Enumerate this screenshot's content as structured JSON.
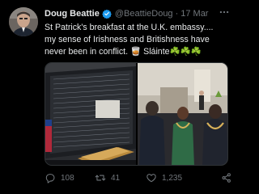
{
  "author": {
    "name": "Doug Beattie",
    "handle": "@BeattieDoug",
    "separator": "·",
    "date": "17 Mar"
  },
  "tweet": {
    "line1": "St Patrick's breakfast at the U.K. embassy....",
    "line2": "my sense of Irishness and Britishness have",
    "line3": "never been in conflict. 🥃 Sláinte☘️☘️☘️"
  },
  "stats": {
    "replies": "108",
    "retweets": "41",
    "likes": "1,235"
  },
  "colors": {
    "background": "#000000",
    "text": "#e7e9ea",
    "muted": "#71767b",
    "verified": "#1d9bf0"
  },
  "icons": {
    "verified": "verified-badge-icon",
    "more": "more-horizontal-icon",
    "reply": "reply-icon",
    "retweet": "retweet-icon",
    "like": "heart-icon",
    "share": "share-icon"
  }
}
